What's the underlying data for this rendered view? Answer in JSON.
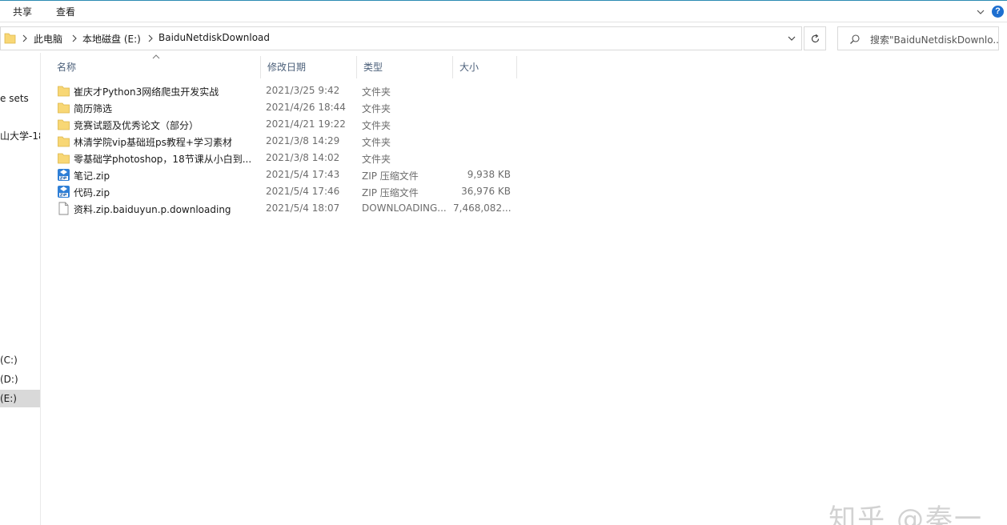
{
  "ribbon": {
    "tabs": [
      "共享",
      "查看"
    ]
  },
  "address": {
    "crumbs": [
      "此电脑",
      "本地磁盘 (E:)",
      "BaiduNetdiskDownload"
    ]
  },
  "search": {
    "placeholder": "搜索\"BaiduNetdiskDownlo..."
  },
  "nav": {
    "items": [
      {
        "label": "e sets",
        "selected": false
      },
      {
        "label": "山大学-18",
        "selected": false
      },
      {
        "label": "(C:)",
        "selected": false
      },
      {
        "label": "(D:)",
        "selected": false
      },
      {
        "label": "(E:)",
        "selected": true
      }
    ]
  },
  "columns": {
    "name": "名称",
    "date": "修改日期",
    "type": "类型",
    "size": "大小"
  },
  "files": [
    {
      "name": "崔庆才Python3网络爬虫开发实战",
      "date": "2021/3/25 9:42",
      "type": "文件夹",
      "size": "",
      "icon": "folder-icon"
    },
    {
      "name": "简历筛选",
      "date": "2021/4/26 18:44",
      "type": "文件夹",
      "size": "",
      "icon": "folder-icon"
    },
    {
      "name": "竞赛试题及优秀论文（部分）",
      "date": "2021/4/21 19:22",
      "type": "文件夹",
      "size": "",
      "icon": "folder-icon"
    },
    {
      "name": "林清学院vip基础班ps教程+学习素材",
      "date": "2021/3/8 14:29",
      "type": "文件夹",
      "size": "",
      "icon": "folder-icon"
    },
    {
      "name": "零基础学photoshop，18节课从小白到...",
      "date": "2021/3/8 14:02",
      "type": "文件夹",
      "size": "",
      "icon": "folder-icon"
    },
    {
      "name": "笔记.zip",
      "date": "2021/5/4 17:43",
      "type": "ZIP 压缩文件",
      "size": "9,938 KB",
      "icon": "zip-icon"
    },
    {
      "name": "代码.zip",
      "date": "2021/5/4 17:46",
      "type": "ZIP 压缩文件",
      "size": "36,976 KB",
      "icon": "zip-icon"
    },
    {
      "name": "资料.zip.baiduyun.p.downloading",
      "date": "2021/5/4 18:07",
      "type": "DOWNLOADING...",
      "size": "7,468,082...",
      "icon": "file-icon"
    }
  ],
  "watermark": "知乎 @秦一",
  "colors": {
    "accent": "#2b8bb3",
    "header_text": "#4c607a",
    "folder": "#f8d775",
    "help": "#1e6fd0"
  }
}
